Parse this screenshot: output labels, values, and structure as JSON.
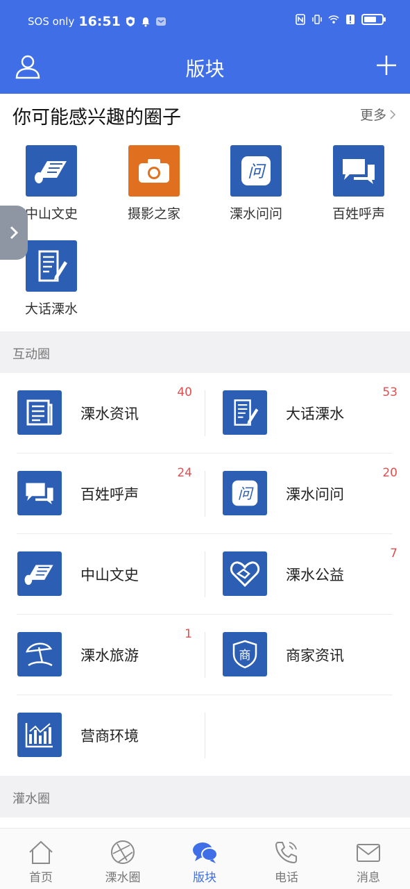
{
  "status_bar": {
    "carrier": "SOS only",
    "time": "16:51",
    "battery_level": 0.6
  },
  "header": {
    "title": "版块",
    "profile_icon": "user-icon",
    "add_icon": "plus-icon"
  },
  "interest": {
    "title": "你可能感兴趣的圈子",
    "more_label": "更多",
    "items": [
      {
        "label": "中山文史",
        "icon": "scroll-icon",
        "color": "#2c5fb3"
      },
      {
        "label": "摄影之家",
        "icon": "camera-icon",
        "color": "#e0701f"
      },
      {
        "label": "溧水问问",
        "icon": "question-icon",
        "color": "#2c5fb3"
      },
      {
        "label": "百姓呼声",
        "icon": "chat-bubbles-icon",
        "color": "#2c5fb3"
      },
      {
        "label": "大话溧水",
        "icon": "document-pen-icon",
        "color": "#2c5fb3"
      }
    ]
  },
  "sections": {
    "interactive": "互动圈",
    "water": "灌水圈"
  },
  "forums": [
    {
      "name": "溧水资讯",
      "count": "40",
      "icon": "newspaper-icon"
    },
    {
      "name": "大话溧水",
      "count": "53",
      "icon": "document-pen-icon"
    },
    {
      "name": "百姓呼声",
      "count": "24",
      "icon": "chat-bubbles-icon"
    },
    {
      "name": "溧水问问",
      "count": "20",
      "icon": "question-icon"
    },
    {
      "name": "中山文史",
      "count": "",
      "icon": "scroll-icon"
    },
    {
      "name": "溧水公益",
      "count": "7",
      "icon": "heart-hands-icon"
    },
    {
      "name": "溧水旅游",
      "count": "1",
      "icon": "beach-umbrella-icon"
    },
    {
      "name": "商家资讯",
      "count": "",
      "icon": "shop-shield-icon"
    },
    {
      "name": "营商环境",
      "count": "",
      "icon": "bar-chart-icon"
    }
  ],
  "bottom_nav": [
    {
      "label": "首页",
      "icon": "home-icon"
    },
    {
      "label": "溧水圈",
      "icon": "aperture-icon"
    },
    {
      "label": "版块",
      "icon": "chat-bubbles-icon",
      "active": true
    },
    {
      "label": "电话",
      "icon": "phone-icon"
    },
    {
      "label": "消息",
      "icon": "mail-icon"
    }
  ],
  "colors": {
    "brand": "#3f6ee6",
    "icon_blue": "#2c5fb3",
    "badge_red": "#e04f4f"
  }
}
